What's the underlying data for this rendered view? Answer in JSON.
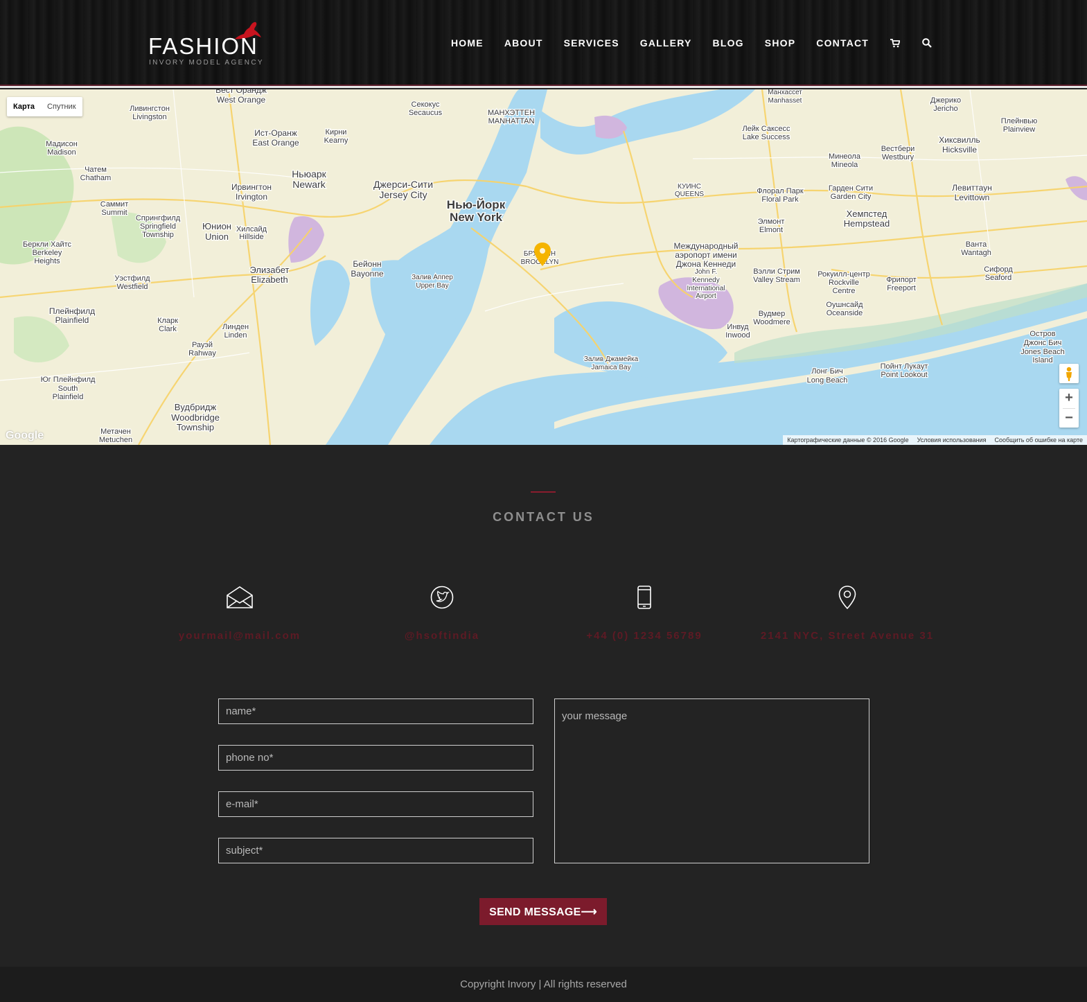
{
  "brand": {
    "title": "FASHION",
    "subtitle": "INVORY  MODEL AGENCY"
  },
  "nav": {
    "items": [
      "HOME",
      "ABOUT",
      "SERVICES",
      "GALLERY",
      "BLOG",
      "SHOP",
      "CONTACT"
    ],
    "cart_icon": "cart-icon",
    "search_icon": "search-icon"
  },
  "map": {
    "toggle_map": "Карта",
    "toggle_satellite": "Спутник",
    "zoom_in": "+",
    "zoom_out": "−",
    "google": "Google",
    "footer": {
      "data": "Картографические данные © 2016 Google",
      "terms": "Условия использования",
      "report": "Сообщить об ошибке на карте"
    },
    "labels": [
      {
        "text": "Нью-Йорк",
        "size": 17,
        "bold": true
      },
      {
        "text": "New York",
        "size": 17,
        "bold": true
      },
      {
        "text": "Ньюарк",
        "size": 14
      },
      {
        "text": "Newark",
        "size": 14
      },
      {
        "text": "Джерси-Сити",
        "size": 14
      },
      {
        "text": "Jersey City",
        "size": 14
      },
      {
        "text": "Хемпстед",
        "size": 13
      },
      {
        "text": "Hempstead",
        "size": 13
      },
      {
        "text": "Элизабет",
        "size": 13
      },
      {
        "text": "Elizabeth",
        "size": 13
      },
      {
        "text": "Юнион",
        "size": 13
      },
      {
        "text": "Union",
        "size": 13
      },
      {
        "text": "Ист-Оранж",
        "size": 12
      },
      {
        "text": "East Orange",
        "size": 12
      },
      {
        "text": "Вест Орандж",
        "size": 12
      },
      {
        "text": "West Orange",
        "size": 12
      },
      {
        "text": "Ливингстон",
        "size": 11
      },
      {
        "text": "Livingston",
        "size": 11
      },
      {
        "text": "Мадисон",
        "size": 11
      },
      {
        "text": "Madison",
        "size": 11
      },
      {
        "text": "Чатем",
        "size": 11
      },
      {
        "text": "Chatham",
        "size": 11
      },
      {
        "text": "Саммит",
        "size": 11
      },
      {
        "text": "Summit",
        "size": 11
      },
      {
        "text": "Ирвингтон",
        "size": 12
      },
      {
        "text": "Irvington",
        "size": 12
      },
      {
        "text": "Хилсайд",
        "size": 11
      },
      {
        "text": "Hillside",
        "size": 11
      },
      {
        "text": "Кирни",
        "size": 11
      },
      {
        "text": "Kearny",
        "size": 11
      },
      {
        "text": "Секокус",
        "size": 11
      },
      {
        "text": "Secaucus",
        "size": 11
      },
      {
        "text": "МАНХЭТТЕН",
        "size": 11
      },
      {
        "text": "MANHATTAN",
        "size": 11
      },
      {
        "text": "Бейонн",
        "size": 12
      },
      {
        "text": "Bayonne",
        "size": 12
      },
      {
        "text": "БРУКЛИН",
        "size": 10
      },
      {
        "text": "BROOKLYN",
        "size": 10
      },
      {
        "text": "КУИНС",
        "size": 10
      },
      {
        "text": "QUEENS",
        "size": 10
      },
      {
        "text": "Международный",
        "size": 12
      },
      {
        "text": "аэропорт имени",
        "size": 12
      },
      {
        "text": "Джона Кеннеди",
        "size": 12
      },
      {
        "text": "John F.",
        "size": 10
      },
      {
        "text": "Kennedy",
        "size": 10
      },
      {
        "text": "International",
        "size": 10
      },
      {
        "text": "Airport",
        "size": 10
      },
      {
        "text": "Залив Аппер",
        "size": 10
      },
      {
        "text": "Upper Bay",
        "size": 10
      },
      {
        "text": "Залив Джамейка",
        "size": 10
      },
      {
        "text": "Jamaica Bay",
        "size": 10
      },
      {
        "text": "Лонг Бич",
        "size": 11
      },
      {
        "text": "Long Beach",
        "size": 11
      },
      {
        "text": "Вэлли Стрим",
        "size": 11
      },
      {
        "text": "Valley Stream",
        "size": 11
      },
      {
        "text": "Рокуилл-центр",
        "size": 11
      },
      {
        "text": "Rockville",
        "size": 11
      },
      {
        "text": "Centre",
        "size": 11
      },
      {
        "text": "Фрипорт",
        "size": 11
      },
      {
        "text": "Freeport",
        "size": 11
      },
      {
        "text": "Левиттаун",
        "size": 12
      },
      {
        "text": "Levittown",
        "size": 12
      },
      {
        "text": "Хиксвилль",
        "size": 12
      },
      {
        "text": "Hicksville",
        "size": 12
      },
      {
        "text": "Манхассет",
        "size": 10
      },
      {
        "text": "Manhasset",
        "size": 10
      },
      {
        "text": "Флорал Парк",
        "size": 11
      },
      {
        "text": "Floral Park",
        "size": 11
      },
      {
        "text": "Элмонт",
        "size": 11
      },
      {
        "text": "Elmont",
        "size": 11
      },
      {
        "text": "Оушнсайд",
        "size": 11
      },
      {
        "text": "Oceanside",
        "size": 11
      },
      {
        "text": "Вудбридж",
        "size": 13
      },
      {
        "text": "Woodbridge",
        "size": 13
      },
      {
        "text": "Township",
        "size": 13
      },
      {
        "text": "Плейнфилд",
        "size": 12
      },
      {
        "text": "Plainfield",
        "size": 12
      },
      {
        "text": "Линден",
        "size": 11
      },
      {
        "text": "Linden",
        "size": 11
      },
      {
        "text": "Рауэй",
        "size": 11
      },
      {
        "text": "Rahway",
        "size": 11
      },
      {
        "text": "Кларк",
        "size": 11
      },
      {
        "text": "Clark",
        "size": 11
      },
      {
        "text": "Уэстфилд",
        "size": 11
      },
      {
        "text": "Westfield",
        "size": 11
      },
      {
        "text": "Метачен",
        "size": 11
      },
      {
        "text": "Metuchen",
        "size": 11
      },
      {
        "text": "Вудмер",
        "size": 11
      },
      {
        "text": "Woodmere",
        "size": 11
      },
      {
        "text": "Инвуд",
        "size": 11
      },
      {
        "text": "Inwood",
        "size": 11
      },
      {
        "text": "Остров",
        "size": 11
      },
      {
        "text": "Джонс Бич",
        "size": 11
      },
      {
        "text": "Jones Beach",
        "size": 11
      },
      {
        "text": "Island",
        "size": 11
      },
      {
        "text": "Пойнт Лукаут",
        "size": 11
      },
      {
        "text": "Point Lookout",
        "size": 11
      },
      {
        "text": "Минеола",
        "size": 11
      },
      {
        "text": "Mineola",
        "size": 11
      },
      {
        "text": "Вестбери",
        "size": 11
      },
      {
        "text": "Westbury",
        "size": 11
      },
      {
        "text": "Гарден Сити",
        "size": 11
      },
      {
        "text": "Garden City",
        "size": 11
      },
      {
        "text": "Лейк Саксесс",
        "size": 11
      },
      {
        "text": "Lake Success",
        "size": 11
      },
      {
        "text": "Джерико",
        "size": 11
      },
      {
        "text": "Jericho",
        "size": 11
      },
      {
        "text": "Плейнвью",
        "size": 11
      },
      {
        "text": "Plainview",
        "size": 11
      },
      {
        "text": "Ванта",
        "size": 11
      },
      {
        "text": "Wantagh",
        "size": 11
      },
      {
        "text": "Сифорд",
        "size": 11
      },
      {
        "text": "Seaford",
        "size": 11
      },
      {
        "text": "Спрингфилд",
        "size": 11
      },
      {
        "text": "Springfield",
        "size": 11
      },
      {
        "text": "Township",
        "size": 11
      },
      {
        "text": "Беркли Хайтс",
        "size": 11
      },
      {
        "text": "Berkeley",
        "size": 11
      },
      {
        "text": "Heights",
        "size": 11
      },
      {
        "text": "Юг Плейнфилд",
        "size": 11
      },
      {
        "text": "South",
        "size": 11
      },
      {
        "text": "Plainfield",
        "size": 11
      }
    ]
  },
  "contact": {
    "title": "CONTACT US",
    "items": [
      {
        "icon": "envelope-icon",
        "value": "yourmail@mail.com"
      },
      {
        "icon": "twitter-icon",
        "value": "@hsoftindia"
      },
      {
        "icon": "mobile-phone-icon",
        "value": "+44 (0) 1234 56789"
      },
      {
        "icon": "map-pin-icon",
        "value": "2141 NYC, Street Avenue 31"
      }
    ],
    "form": {
      "name_placeholder": "name*",
      "phone_placeholder": "phone no*",
      "email_placeholder": "e-mail*",
      "subject_placeholder": "subject*",
      "message_placeholder": "your message",
      "send_label": "SEND MESSAGE⟶"
    }
  },
  "footer": {
    "copyright": "Copyright Invory | All rights reserved"
  },
  "colors": {
    "accent": "#7c1b2c",
    "background": "#232323",
    "contact_value": "#5e1a24"
  }
}
